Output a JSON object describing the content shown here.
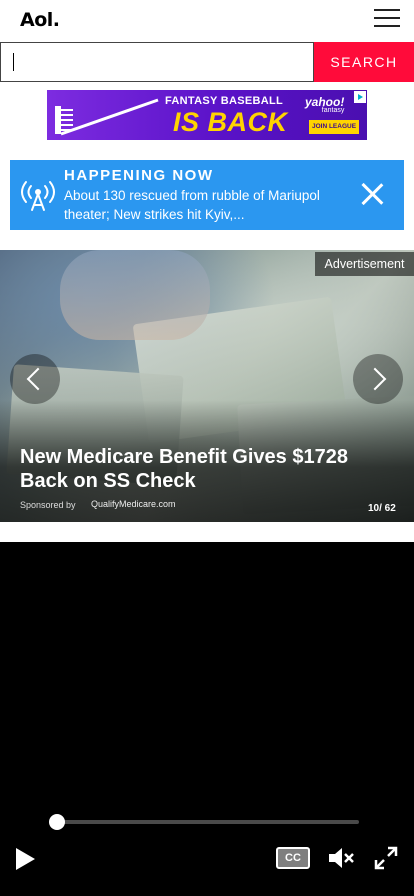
{
  "header": {
    "logo_text": "Aol.",
    "menu_icon": "hamburger-menu-icon"
  },
  "search": {
    "placeholder": "",
    "value": "",
    "button_label": "SEARCH"
  },
  "ad_banner": {
    "line1": "FANTASY BASEBALL",
    "line2": "IS BACK",
    "brand": "yahoo!",
    "brand_sub": "fantasy",
    "cta": "JOIN LEAGUE",
    "colors": {
      "background": "#5a12c8",
      "accent": "#ffd400"
    }
  },
  "happening_now": {
    "title": "HAPPENING NOW",
    "text": "About 130 rescued from rubble of Mariupol theater; New strikes hit Kyiv,...",
    "icon": "broadcast-antenna-icon",
    "close_icon": "close-icon",
    "color": "#2b97f0"
  },
  "gallery": {
    "ad_label": "Advertisement",
    "title": "New Medicare Benefit Gives $1728 Back on SS Check",
    "sponsored_by": "Sponsored by",
    "sponsor_name": "QualifyMedicare.com",
    "counter": "10/ 62",
    "prev_icon": "chevron-left-icon",
    "next_icon": "chevron-right-icon"
  },
  "video": {
    "progress": 0.0,
    "play_icon": "play-icon",
    "cc_label": "CC",
    "mute_icon": "muted-speaker-icon",
    "fullscreen_icon": "fullscreen-icon"
  },
  "colors": {
    "search_button": "#ff0b3a"
  }
}
